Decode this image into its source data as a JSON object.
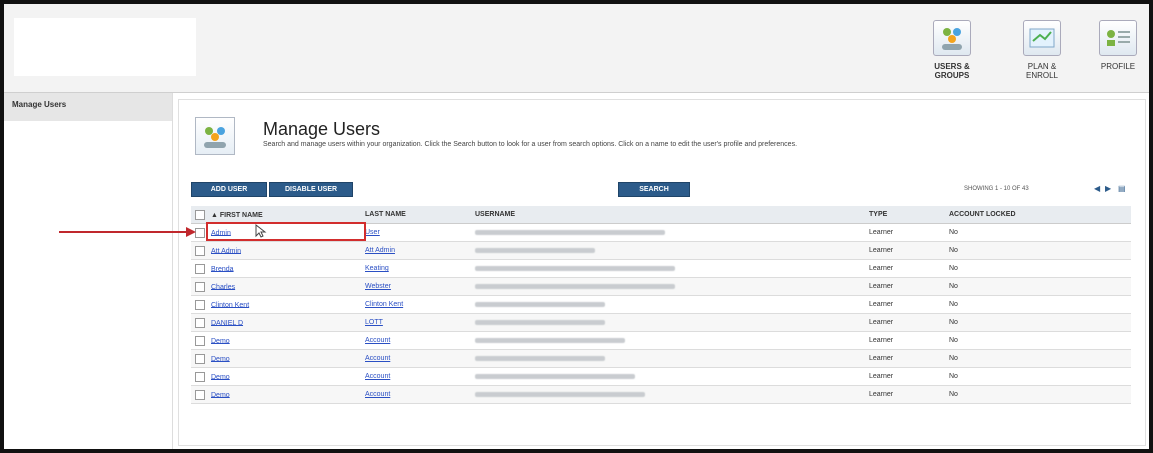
{
  "nav": {
    "items": [
      {
        "label": "USERS & GROUPS",
        "active": true
      },
      {
        "label": "PLAN & ENROLL",
        "active": false
      },
      {
        "label": "PROFILE",
        "active": false
      }
    ]
  },
  "sidebar": {
    "items": [
      {
        "label": "Manage Users"
      }
    ]
  },
  "page": {
    "title": "Manage Users",
    "description": "Search and manage users within your organization. Click the Search button to look for a user from search options. Click on a name to edit the user's profile and preferences."
  },
  "toolbar": {
    "add_user": "ADD USER",
    "disable_user": "DISABLE USER",
    "search": "SEARCH",
    "showing": "SHOWING 1 - 10 OF 43"
  },
  "table": {
    "headers": {
      "first_name": "▲ FIRST NAME",
      "last_name": "LAST NAME",
      "username": "USERNAME",
      "type": "TYPE",
      "account_locked": "ACCOUNT LOCKED"
    },
    "rows": [
      {
        "first": "Admin",
        "last": "User",
        "type": "Learner",
        "locked": "No"
      },
      {
        "first": "Att Admin",
        "last": "Att Admin",
        "type": "Learner",
        "locked": "No"
      },
      {
        "first": "Brenda",
        "last": "Keating",
        "type": "Learner",
        "locked": "No"
      },
      {
        "first": "Charles",
        "last": "Webster",
        "type": "Learner",
        "locked": "No"
      },
      {
        "first": "Clinton Kent",
        "last": "Clinton Kent",
        "type": "Learner",
        "locked": "No"
      },
      {
        "first": "DANIEL D",
        "last": "LOTT",
        "type": "Learner",
        "locked": "No"
      },
      {
        "first": "Demo",
        "last": "Account",
        "type": "Learner",
        "locked": "No"
      },
      {
        "first": "Demo",
        "last": "Account",
        "type": "Learner",
        "locked": "No"
      },
      {
        "first": "Demo",
        "last": "Account",
        "type": "Learner",
        "locked": "No"
      },
      {
        "first": "Demo",
        "last": "Account",
        "type": "Learner",
        "locked": "No"
      }
    ]
  }
}
